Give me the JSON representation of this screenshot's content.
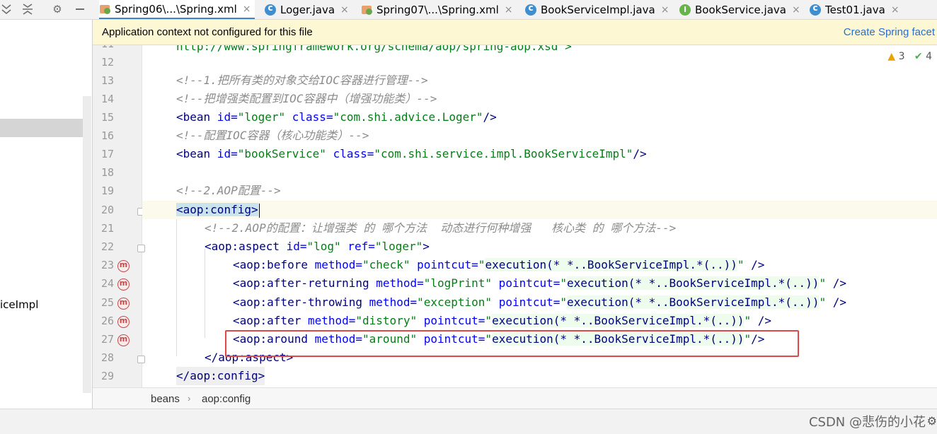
{
  "tabs": [
    {
      "label": "Spring06\\...\\Spring.xml",
      "icon": "xml-file-icon",
      "active": true
    },
    {
      "label": "Loger.java",
      "icon": "class-icon"
    },
    {
      "label": "Spring07\\...\\Spring.xml",
      "icon": "xml-file-icon"
    },
    {
      "label": "BookServiceImpl.java",
      "icon": "class-icon"
    },
    {
      "label": "BookService.java",
      "icon": "interface-icon"
    },
    {
      "label": "Test01.java",
      "icon": "class-icon"
    }
  ],
  "tab_close_glyph": "×",
  "notification": {
    "text": "Application context not configured for this file",
    "action": "Create Spring facet"
  },
  "inspections": {
    "warnings": "3",
    "ok": "4"
  },
  "project_tree": {
    "partial_label": "iceImpl"
  },
  "code": {
    "line11_partial": "http://www.springframework.org/schema/aop/spring-aop.xsd\">",
    "line_numbers": [
      "11",
      "12",
      "13",
      "14",
      "15",
      "16",
      "17",
      "18",
      "19",
      "20",
      "21",
      "22",
      "23",
      "24",
      "25",
      "26",
      "27",
      "28",
      "29"
    ],
    "c13": "<!--1.把所有类的对象交给IOC容器进行管理-->",
    "c14": "<!--把增强类配置到IOC容器中（增强功能类）-->",
    "l15": {
      "open": "<bean",
      "a1": " id=",
      "v1": "\"loger\"",
      "a2": " class=",
      "v2": "\"com.shi.advice.Loger\"",
      "close": "/>"
    },
    "c16": "<!--配置IOC容器（核心功能类）-->",
    "l17": {
      "open": "<bean",
      "a1": " id=",
      "v1": "\"bookService\"",
      "a2": " class=",
      "v2": "\"com.shi.service.impl.BookServiceImpl\"",
      "close": "/>"
    },
    "c19": "<!--2.AOP配置-->",
    "l20": {
      "lt": "<",
      "tag": "aop:config",
      "gt": ">"
    },
    "c21": "<!--2.AOP的配置：让增强类 的 哪个方法  动态进行何种增强   核心类 的 哪个方法-->",
    "l22": {
      "open": "<aop:aspect",
      "a1": " id=",
      "v1": "\"log\"",
      "a2": " ref=",
      "v2": "\"loger\"",
      "close": ">"
    },
    "l23": {
      "open": "<aop:before",
      "a1": " method=",
      "v1": "\"check\"",
      "a2": " pointcut=",
      "q1": "\"",
      "exec": "execution(* *..BookServiceImpl.*(..))",
      "q2": "\"",
      "close": " />"
    },
    "l24": {
      "open": "<aop:after-returning",
      "a1": " method=",
      "v1": "\"logPrint\"",
      "a2": " pointcut=",
      "q1": "\"",
      "exec": "execution(* *..BookServiceImpl.*(..))",
      "q2": "\"",
      "close": " />"
    },
    "l25": {
      "open": "<aop:after-throwing",
      "a1": " method=",
      "v1": "\"exception\"",
      "a2": " pointcut=",
      "q1": "\"",
      "exec": "execution(* *..BookServiceImpl.*(..))",
      "q2": "\"",
      "close": " />"
    },
    "l26": {
      "open": "<aop:after",
      "a1": " method=",
      "v1": "\"distory\"",
      "a2": " pointcut=",
      "q1": "\"",
      "exec": "execution(* *..BookServiceImpl.*(..))",
      "q2": "\"",
      "close": " />"
    },
    "l27": {
      "open": "<aop:around",
      "a1": " method=",
      "v1": "\"around\"",
      "a2": " pointcut=",
      "q1": "\"",
      "exec": "execution(* *..BookServiceImpl.*(..))",
      "q2": "\"",
      "close": "/>"
    },
    "l28": "</aop:aspect>",
    "l29": "</aop:config>"
  },
  "breadcrumb": {
    "item1": "beans",
    "sep": "›",
    "item2": "aop:config"
  },
  "watermark": "CSDN @悲伤的小花"
}
